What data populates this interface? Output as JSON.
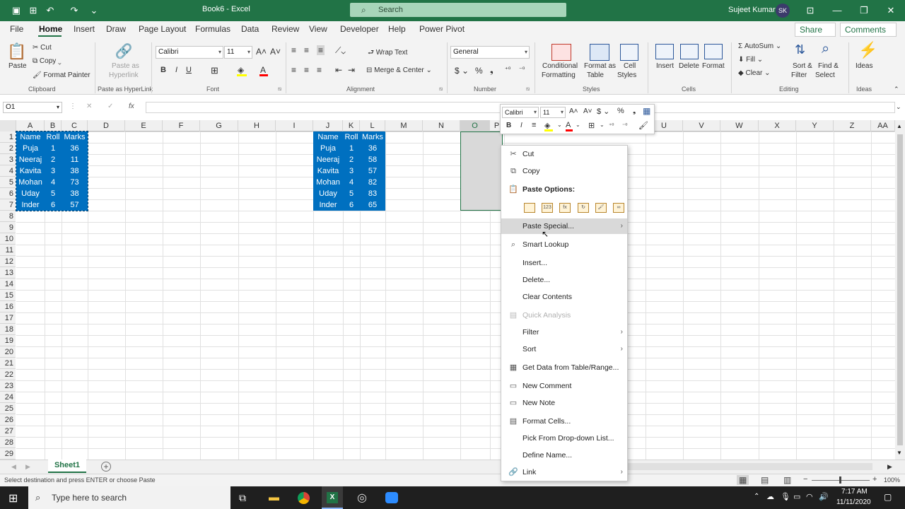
{
  "window": {
    "title": "Book6  -  Excel",
    "search_placeholder": "Search",
    "user": "Sujeet Kumar",
    "avatar": "SK"
  },
  "menu_tabs": [
    "File",
    "Home",
    "Insert",
    "Draw",
    "Page Layout",
    "Formulas",
    "Data",
    "Review",
    "View",
    "Developer",
    "Help",
    "Power Pivot"
  ],
  "share": "Share",
  "comments": "Comments",
  "ribbon": {
    "clipboard": {
      "paste": "Paste",
      "cut": "Cut",
      "copy": "Copy",
      "format_painter": "Format Painter",
      "label": "Clipboard"
    },
    "hyperlink": {
      "line1": "Paste as",
      "line2": "Hyperlink",
      "label": "Paste as HyperLink"
    },
    "font": {
      "name": "Calibri",
      "size": "11",
      "label": "Font",
      "bold": "B",
      "italic": "I",
      "underline": "U"
    },
    "alignment": {
      "wrap": "Wrap Text",
      "merge": "Merge & Center",
      "label": "Alignment"
    },
    "number": {
      "format": "General",
      "label": "Number"
    },
    "styles": {
      "cond1": "Conditional",
      "cond2": "Formatting",
      "fat1": "Format as",
      "fat2": "Table",
      "cs1": "Cell",
      "cs2": "Styles",
      "label": "Styles"
    },
    "cells": {
      "insert": "Insert",
      "delete": "Delete",
      "format": "Format",
      "label": "Cells"
    },
    "editing": {
      "autosum": "AutoSum",
      "fill": "Fill",
      "clear": "Clear",
      "sort1": "Sort &",
      "sort2": "Filter",
      "find1": "Find &",
      "find2": "Select",
      "label": "Editing"
    },
    "ideas": {
      "btn": "Ideas",
      "label": "Ideas"
    }
  },
  "formula_bar": {
    "name_box": "O1",
    "fx": "fx",
    "cancel": "✕",
    "enter": "✓"
  },
  "columns": [
    "A",
    "B",
    "C",
    "D",
    "E",
    "F",
    "G",
    "H",
    "I",
    "J",
    "K",
    "L",
    "M",
    "N",
    "O",
    "P",
    "U",
    "V",
    "W",
    "X",
    "Y",
    "Z",
    "AA"
  ],
  "rows": [
    "1",
    "2",
    "3",
    "4",
    "5",
    "6",
    "7",
    "8",
    "9",
    "10",
    "11",
    "12",
    "13",
    "14",
    "15",
    "16",
    "17",
    "18",
    "19",
    "20",
    "21",
    "22",
    "23",
    "24",
    "25",
    "26",
    "27",
    "28",
    "29"
  ],
  "table1": {
    "header": [
      "Name",
      "Roll",
      "Marks"
    ],
    "rows": [
      [
        "Puja",
        "1",
        "36"
      ],
      [
        "Neeraj",
        "2",
        "11"
      ],
      [
        "Kavita",
        "3",
        "38"
      ],
      [
        "Mohan",
        "4",
        "73"
      ],
      [
        "Uday",
        "5",
        "38"
      ],
      [
        "Inder",
        "6",
        "57"
      ]
    ]
  },
  "table2": {
    "header": [
      "Name",
      "Roll",
      "Marks"
    ],
    "rows": [
      [
        "Puja",
        "1",
        "36"
      ],
      [
        "Neeraj",
        "2",
        "58"
      ],
      [
        "Kavita",
        "3",
        "57"
      ],
      [
        "Mohan",
        "4",
        "82"
      ],
      [
        "Uday",
        "5",
        "83"
      ],
      [
        "Inder",
        "6",
        "65"
      ]
    ]
  },
  "mini_toolbar": {
    "font": "Calibri",
    "size": "11"
  },
  "context_menu": {
    "cut": "Cut",
    "copy": "Copy",
    "paste_options": "Paste Options:",
    "paste_special": "Paste Special...",
    "smart_lookup": "Smart Lookup",
    "insert": "Insert...",
    "delete": "Delete...",
    "clear_contents": "Clear Contents",
    "quick_analysis": "Quick Analysis",
    "filter": "Filter",
    "sort": "Sort",
    "get_data": "Get Data from Table/Range...",
    "new_comment": "New Comment",
    "new_note": "New Note",
    "format_cells": "Format Cells...",
    "pick_list": "Pick From Drop-down List...",
    "define_name": "Define Name...",
    "link": "Link"
  },
  "sheet": {
    "name": "Sheet1",
    "add": "+"
  },
  "status": {
    "message": "Select destination and press ENTER or choose Paste",
    "zoom": "100%"
  },
  "taskbar": {
    "search": "Type here to search",
    "time": "7:17 AM",
    "date": "11/11/2020"
  },
  "colors": {
    "excel_green": "#217346",
    "table_fill": "#0070c0"
  }
}
